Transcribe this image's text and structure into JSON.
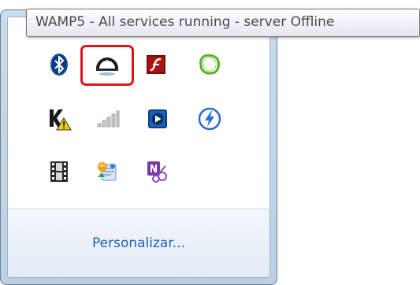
{
  "tooltip": {
    "text": "WAMP5 - All services running - server Offline"
  },
  "flyout": {
    "link_label": "Personalizar...",
    "link_color": "#1e63b8",
    "highlight_color": "#e0141c",
    "icons": [
      {
        "name": "bluetooth-icon"
      },
      {
        "name": "wamp5-gauge-icon",
        "highlighted": true
      },
      {
        "name": "adobe-flash-icon"
      },
      {
        "name": "green-blob-app-icon"
      },
      {
        "name": "kaspersky-warning-icon"
      },
      {
        "name": "network-signal-icon"
      },
      {
        "name": "blue-media-player-icon"
      },
      {
        "name": "lightning-bolt-icon"
      },
      {
        "name": "film-strip-icon"
      },
      {
        "name": "colorful-app-icon"
      },
      {
        "name": "onenote-clipper-icon"
      }
    ]
  }
}
